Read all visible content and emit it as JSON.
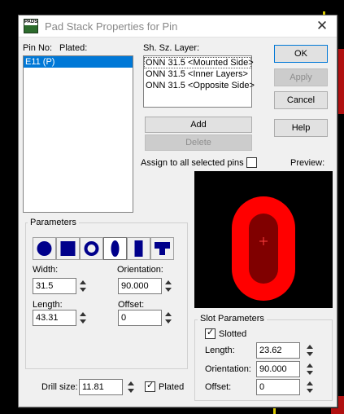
{
  "dialog": {
    "title": "Pad Stack Properties for Pin",
    "app_icon_text_top": "PADS",
    "close_glyph": "✕"
  },
  "pins": {
    "pin_no_label": "Pin No:",
    "plated_label": "Plated:",
    "items": [
      "E11 (P)"
    ]
  },
  "layers": {
    "header": "Sh. Sz. Layer:",
    "items": [
      "ONN 31.5 <Mounted Side>",
      "ONN 31.5 <Inner Layers>",
      "ONN 31.5 <Opposite Side>"
    ]
  },
  "buttons": {
    "ok": "OK",
    "apply": "Apply",
    "cancel": "Cancel",
    "help": "Help",
    "add": "Add",
    "delete": "Delete"
  },
  "assign_all": {
    "label": "Assign to all selected pins",
    "checked": false
  },
  "preview": {
    "label": "Preview:",
    "outer_color": "#ff0000",
    "inner_color": "#800000",
    "cross_color": "#ff4040"
  },
  "parameters": {
    "title": "Parameters",
    "shapes": [
      "round-shape",
      "square-shape",
      "annular-shape",
      "oval-shape",
      "rectangle-shape",
      "odd-shape"
    ],
    "selected_shape": "oval-shape",
    "width_label": "Width:",
    "width_value": "31.5",
    "orientation_label": "Orientation:",
    "orientation_value": "90.000",
    "length_label": "Length:",
    "length_value": "43.31",
    "offset_label": "Offset:",
    "offset_value": "0"
  },
  "slot": {
    "title": "Slot Parameters",
    "slotted_label": "Slotted",
    "slotted_checked": true,
    "length_label": "Length:",
    "length_value": "23.62",
    "orientation_label": "Orientation:",
    "orientation_value": "90.000",
    "offset_label": "Offset:",
    "offset_value": "0"
  },
  "drill": {
    "label": "Drill size:",
    "value": "11.81",
    "plated_label": "Plated",
    "plated_checked": true
  },
  "colors": {
    "selection": "#0078d7",
    "shape_fill": "#00008b",
    "pcb_red": "#b01010",
    "pcb_yellow": "#d8c800"
  }
}
